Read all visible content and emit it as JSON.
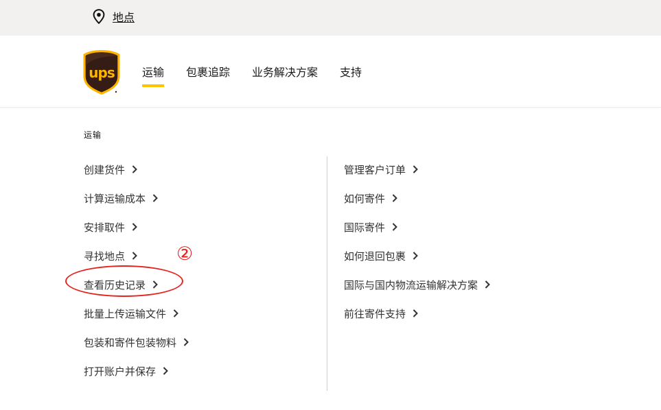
{
  "topbar": {
    "location_label": "地点"
  },
  "header": {
    "logo_text": "ups",
    "nav": [
      {
        "label": "运输",
        "active": true
      },
      {
        "label": "包裹追踪",
        "active": false
      },
      {
        "label": "业务解决方案",
        "active": false
      },
      {
        "label": "支持",
        "active": false
      }
    ]
  },
  "menu": {
    "section_title": "运输",
    "left_items": [
      "创建货件",
      "计算运输成本",
      "安排取件",
      "寻找地点",
      "查看历史记录",
      "批量上传运输文件",
      "包装和寄件包装物料",
      "打开账户并保存"
    ],
    "right_items": [
      "管理客户订单",
      "如何寄件",
      "国际寄件",
      "如何退回包裹",
      "国际与国内物流运输解决方案",
      "前往寄件支持"
    ]
  },
  "annotation": {
    "step_number": "②",
    "color": "#e5221d"
  },
  "colors": {
    "brand_brown": "#351c15",
    "brand_gold": "#ffb500",
    "accent_underline": "#ffc400"
  },
  "icons": {
    "location": "location-pin-icon",
    "chevron": "chevron-right-icon"
  }
}
